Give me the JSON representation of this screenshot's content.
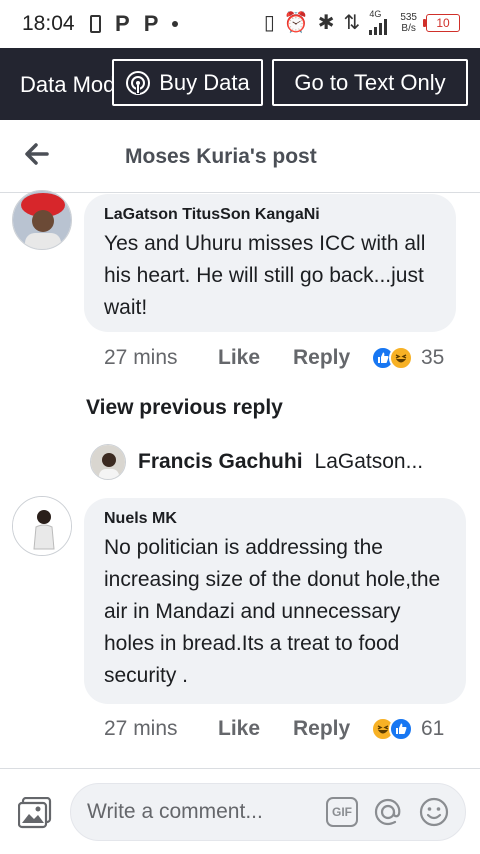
{
  "status_bar": {
    "time": "18:04",
    "network_type": "4G",
    "net_speed_value": "535",
    "net_speed_unit": "B/s",
    "battery_level": "10"
  },
  "data_bar": {
    "mode_label": "Data Mode",
    "buy_data_label": "Buy Data",
    "text_only_label": "Go to Text Only"
  },
  "post_header": {
    "title": "Moses Kuria's post"
  },
  "comments": [
    {
      "author": "LaGatson TitusSon KangaNi",
      "text": "Yes and Uhuru misses ICC with all his heart. He will still go back...just wait!",
      "time": "27 mins",
      "like_label": "Like",
      "reply_label": "Reply",
      "reaction_count": "35"
    },
    {
      "author": "Nuels MK",
      "text": "No politician is addressing  the increasing size of the donut hole,the air in Mandazi and unnecessary holes in bread.Its a treat to food security .",
      "time": "27 mins",
      "like_label": "Like",
      "reply_label": "Reply",
      "reaction_count": "61"
    }
  ],
  "view_previous_reply": "View previous reply",
  "reply_preview": {
    "author": "Francis Gachuhi",
    "snippet": "LaGatson..."
  },
  "composer": {
    "placeholder": "Write a comment...",
    "gif_label": "GIF"
  }
}
